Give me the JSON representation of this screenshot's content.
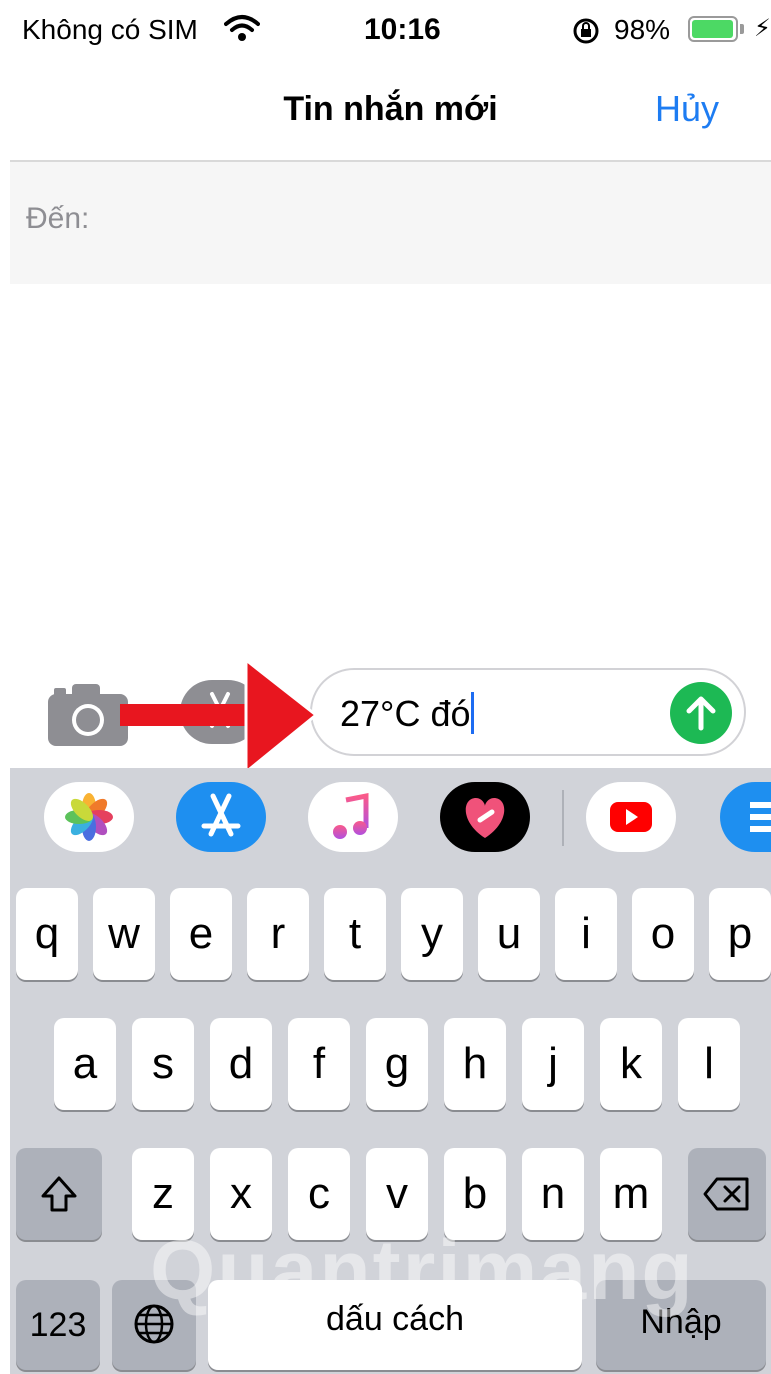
{
  "status_bar": {
    "carrier": "Không có SIM",
    "time": "10:16",
    "battery_percent": "98%",
    "battery_level": 0.98,
    "wifi_icon": "wifi-icon",
    "lock_icon": "orientation-lock-icon",
    "charging_icon": "charging-bolt-icon"
  },
  "nav": {
    "title": "Tin nhắn mới",
    "cancel_label": "Hủy"
  },
  "recipient": {
    "label": "Đến:"
  },
  "compose": {
    "text": "27°C đó",
    "camera_icon": "camera-icon",
    "appstore_icon": "appstore-icon",
    "send_icon": "send-arrow-icon",
    "annotation_arrow_color": "#e8161f"
  },
  "app_strip": {
    "apps": [
      "photos-icon",
      "appstore-icon",
      "music-icon",
      "digital-touch-icon",
      "youtube-icon",
      "app-icon"
    ]
  },
  "keyboard": {
    "row1": [
      "q",
      "w",
      "e",
      "r",
      "t",
      "y",
      "u",
      "i",
      "o",
      "p"
    ],
    "row2": [
      "a",
      "s",
      "d",
      "f",
      "g",
      "h",
      "j",
      "k",
      "l"
    ],
    "row3": [
      "z",
      "x",
      "c",
      "v",
      "b",
      "n",
      "m"
    ],
    "numbers_label": "123",
    "space_label": "dấu cách",
    "return_label": "Nhập",
    "shift_icon": "shift-icon",
    "delete_icon": "delete-icon",
    "globe_icon": "globe-icon"
  },
  "watermark": "Quantrimang",
  "colors": {
    "accent": "#1d7cf2",
    "send_green": "#1db954",
    "keyboard_bg": "#d1d3d9"
  }
}
